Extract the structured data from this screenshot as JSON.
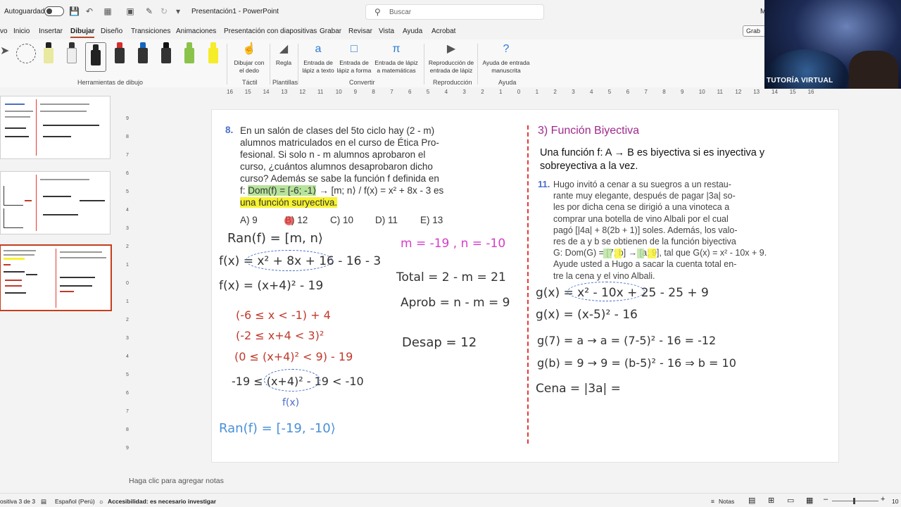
{
  "titlebar": {
    "autosave_label": "Autoguardado",
    "doc_title": "Presentación1 - PowerPoint",
    "search_placeholder": "Buscar",
    "user_initial": "M"
  },
  "menu": {
    "items": [
      "vo",
      "Inicio",
      "Insertar",
      "Dibujar",
      "Diseño",
      "Transiciones",
      "Animaciones",
      "Presentación con diapositivas",
      "Grabar",
      "Revisar",
      "Vista",
      "Ayuda",
      "Acrobat"
    ],
    "active": "Dibujar",
    "record_label": "Grab"
  },
  "ribbon": {
    "groups": {
      "drawing_tools": "Herramientas de dibujo",
      "touch": "Táctil",
      "templates": "Plantillas",
      "convert": "Convertir",
      "playback": "Reproducción",
      "help": "Ayuda"
    },
    "buttons": {
      "draw_finger": "Dibujar con el dedo",
      "ruler": "Regla",
      "ink_to_text": "Entrada de lápiz a texto",
      "ink_to_shape": "Entrada de lápiz a forma",
      "ink_to_math": "Entrada de lápiz a matemáticas",
      "ink_replay": "Reproducción de entrada de lápiz",
      "ink_help": "Ayuda de entrada manuscrita"
    },
    "pens": [
      {
        "color": "#e9e9a0"
      },
      {
        "color": "#333333"
      },
      {
        "color": "#222222"
      },
      {
        "color": "#d32f2f"
      },
      {
        "color": "#1565c0"
      },
      {
        "color": "#111111"
      },
      {
        "color": "#8bc34a"
      },
      {
        "color": "#f5ec2a"
      }
    ]
  },
  "webcam": {
    "caption": "TUTORÍA VIRTUAL"
  },
  "ruler": {
    "ticks": [
      "16",
      "15",
      "14",
      "13",
      "12",
      "11",
      "10",
      "9",
      "8",
      "7",
      "6",
      "5",
      "4",
      "3",
      "2",
      "1",
      "0",
      "1",
      "2",
      "3",
      "4",
      "5",
      "6",
      "7",
      "8",
      "9",
      "10",
      "11",
      "12",
      "13",
      "14",
      "15",
      "16"
    ]
  },
  "vruler": {
    "ticks": [
      "9",
      "8",
      "7",
      "6",
      "5",
      "4",
      "3",
      "2",
      "1",
      "0",
      "1",
      "2",
      "3",
      "4",
      "5",
      "6",
      "7",
      "8",
      "9"
    ]
  },
  "slide": {
    "left": {
      "q_number": "8.",
      "q_lines": [
        "En un salón de clases del 5to ciclo hay (2 - m)",
        "alumnos matriculados en el curso de Ética Pro-",
        "fesional. Si solo n - m alumnos aprobaron el",
        "curso, ¿cuántos alumnos desaprobaron dicho",
        "curso? Además se sabe la función f definida en"
      ],
      "q_line6_pre": "f: ",
      "q_line6_dom": "Dom(f) = [-6; -1⟩",
      "q_line6_post": " → [m; n⟩ / f(x) = x² + 8x - 3 es",
      "q_line7": "una función suryectiva.",
      "options": [
        "A) 9",
        "B) 12",
        "C) 10",
        "D) 11",
        "E) 13"
      ],
      "hw": {
        "ran": "Ran(f) = [m, n⟩",
        "f1": "f(x) = x² + 8x + 16 - 16 - 3",
        "f2": "f(x) = (x+4)² - 19",
        "m1": "(-6 ≤ x < -1) + 4",
        "m2": "(-2 ≤ x+4 < 3)²",
        "m3": "(0 ≤ (x+4)² < 9) - 19",
        "m4": "-19 ≤ (x+4)² - 19 < -10",
        "fx": "f(x)",
        "ran2": "Ran(f) = [-19, -10⟩",
        "mn": "m = -19 , n = -10",
        "total": "Total = 2 - m = 21",
        "aprob": "Aprob = n - m = 9",
        "desap": "Desap = 12"
      }
    },
    "right": {
      "heading": "3) Función Biyectiva",
      "def1": "Una función f: A → B es biyectiva si es inyectiva y",
      "def2": "sobreyectiva a la vez.",
      "q_number": "11.",
      "q_lines": [
        "Hugo invitó a cenar a su suegros a un restau-",
        "rante muy elegante, después de pagar |3a| so-",
        "les por dicha cena se dirigió a una vinoteca a",
        "comprar una botella de vino Albali  por el cual",
        "pagó [|4a| + 8(2b + 1)] soles. Además, los valo-",
        "res de a y b se obtienen de la función biyectiva"
      ],
      "q_line7": "G: Dom(G) = [7; b] → [a; 9], tal que G(x) = x² - 10x + 9.",
      "q_line8": "Ayude usted a Hugo a sacar la cuenta total en-",
      "q_line9": "tre la cena y el vino Albali.",
      "hw": {
        "g1": "g(x) = x² - 10x + 25 - 25 + 9",
        "g2": "g(x) = (x-5)² - 16",
        "g3": "g(7) = a → a = (7-5)² - 16 = -12",
        "g4": "g(b) = 9 → 9 = (b-5)² - 16 ⇒ b = 10",
        "cena": "Cena = |3a| ="
      }
    }
  },
  "notes_placeholder": "Haga clic para agregar notas",
  "status": {
    "slide": "ositiva 3 de 3",
    "language": "Español (Perú)",
    "accessibility": "Accesibilidad: es necesario investigar",
    "notes": "Notas",
    "zoom": "10"
  }
}
